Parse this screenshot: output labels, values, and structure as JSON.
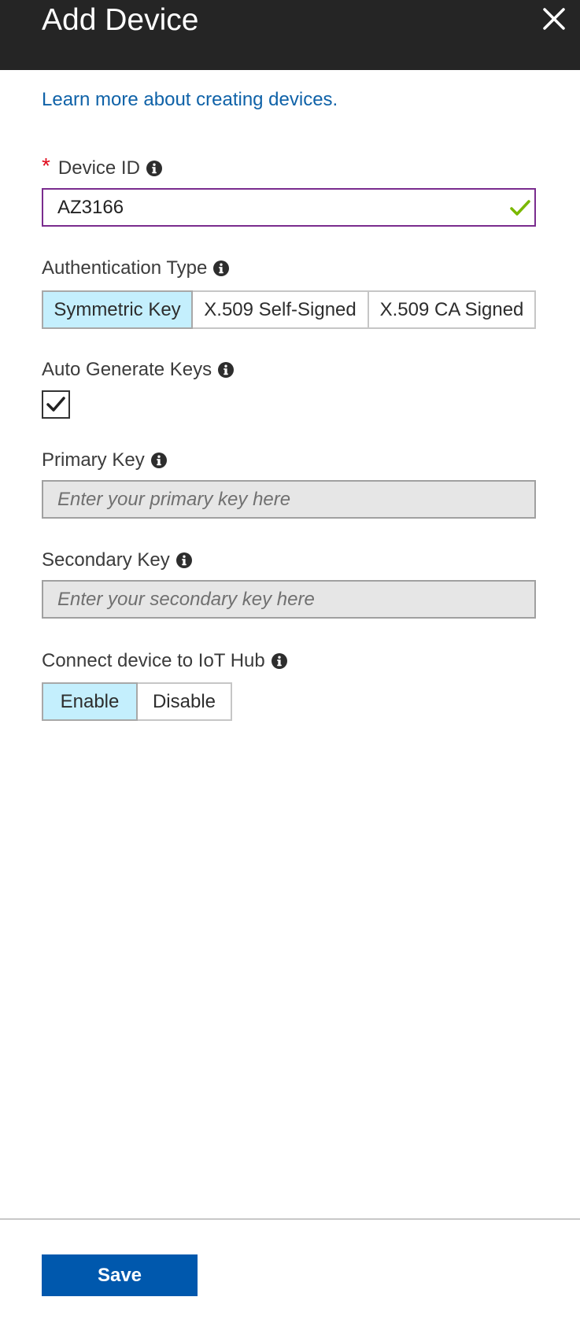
{
  "header": {
    "title": "Add Device"
  },
  "learn_more_link": "Learn more about creating devices.",
  "device_id": {
    "required_marker": "*",
    "label": "Device ID",
    "value": "AZ3166"
  },
  "authentication_type": {
    "label": "Authentication Type",
    "options": [
      "Symmetric Key",
      "X.509 Self-Signed",
      "X.509 CA Signed"
    ],
    "selected": "Symmetric Key"
  },
  "auto_generate_keys": {
    "label": "Auto Generate Keys",
    "checked": true
  },
  "primary_key": {
    "label": "Primary Key",
    "placeholder": "Enter your primary key here"
  },
  "secondary_key": {
    "label": "Secondary Key",
    "placeholder": "Enter your secondary key here"
  },
  "connect_to_hub": {
    "label": "Connect device to IoT Hub",
    "options": [
      "Enable",
      "Disable"
    ],
    "selected": "Enable"
  },
  "footer": {
    "save_label": "Save"
  },
  "colors": {
    "header_bg": "#252525",
    "link": "#0f62a8",
    "required": "#e00b1c",
    "focus_border": "#7a2c8e",
    "valid_check": "#7ab800",
    "selected_segment": "#c4effd",
    "save_button": "#0058ad"
  },
  "icons": {
    "close": "close-icon",
    "info": "info-icon",
    "valid": "checkmark-icon",
    "checkbox_check": "checkmark-icon"
  }
}
